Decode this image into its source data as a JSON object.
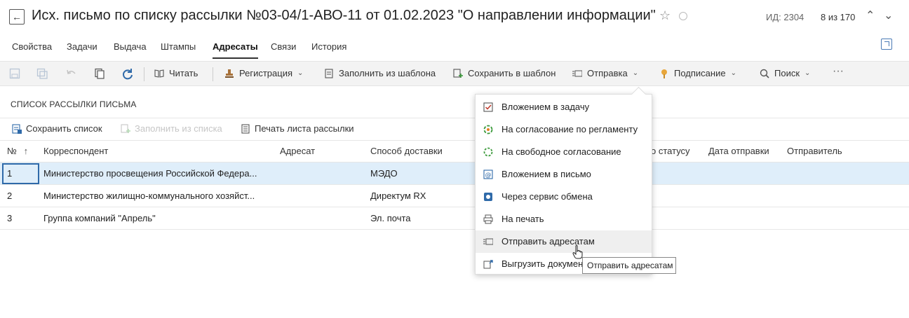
{
  "header": {
    "title": "Исх. письмо по списку рассылки №03-04/1-АВО-11 от 01.02.2023 \"О направлении информации\"",
    "id_label": "ИД: 2304",
    "counter": "8 из 170"
  },
  "tabs": [
    {
      "label": "Свойства"
    },
    {
      "label": "Задачи"
    },
    {
      "label": "Выдача"
    },
    {
      "label": "Штампы"
    },
    {
      "label": "Адресаты"
    },
    {
      "label": "Связи"
    },
    {
      "label": "История"
    }
  ],
  "toolbar": {
    "read": "Читать",
    "registration": "Регистрация",
    "fill_template": "Заполнить из шаблона",
    "save_template": "Сохранить в шаблон",
    "send": "Отправка",
    "signing": "Подписание",
    "search": "Поиск",
    "more": "···"
  },
  "section": {
    "title": "СПИСОК РАССЫЛКИ ПИСЬМА",
    "save_list": "Сохранить список",
    "fill_from_list": "Заполнить из списка",
    "print_list": "Печать листа рассылки"
  },
  "table": {
    "columns": [
      "№",
      "Корреспондент",
      "Адресат",
      "Способ доставки",
      "По статусу",
      "Дата отправки",
      "Отправитель"
    ],
    "sort_indicator": "↑",
    "partial_status_header": "о статусу",
    "rows": [
      {
        "num": "1",
        "correspondent": "Министерство просвещения Российской Федера...",
        "addressee": "",
        "delivery": "МЭДО"
      },
      {
        "num": "2",
        "correspondent": "Министерство жилищно-коммунального хозяйст...",
        "addressee": "",
        "delivery": "Директум RX"
      },
      {
        "num": "3",
        "correspondent": "Группа компаний \"Апрель\"",
        "addressee": "",
        "delivery": "Эл. почта"
      }
    ]
  },
  "send_menu": {
    "items": [
      {
        "label": "Вложением в задачу",
        "icon": "task-attach-icon"
      },
      {
        "label": "На согласование по регламенту",
        "icon": "approval-regulation-icon"
      },
      {
        "label": "На свободное согласование",
        "icon": "free-approval-icon"
      },
      {
        "label": "Вложением в письмо",
        "icon": "email-attach-icon"
      },
      {
        "label": "Через сервис обмена",
        "icon": "exchange-service-icon"
      },
      {
        "label": "На печать",
        "icon": "print-icon"
      },
      {
        "label": "Отправить адресатам",
        "icon": "send-addressees-icon"
      },
      {
        "label": "Выгрузить докумен",
        "icon": "export-document-icon"
      }
    ],
    "tooltip": "Отправить адресатам"
  },
  "colors": {
    "accent": "#2f6aa9",
    "selected_row": "#dfeefa",
    "toolbar_bg": "#f3f3f3"
  }
}
